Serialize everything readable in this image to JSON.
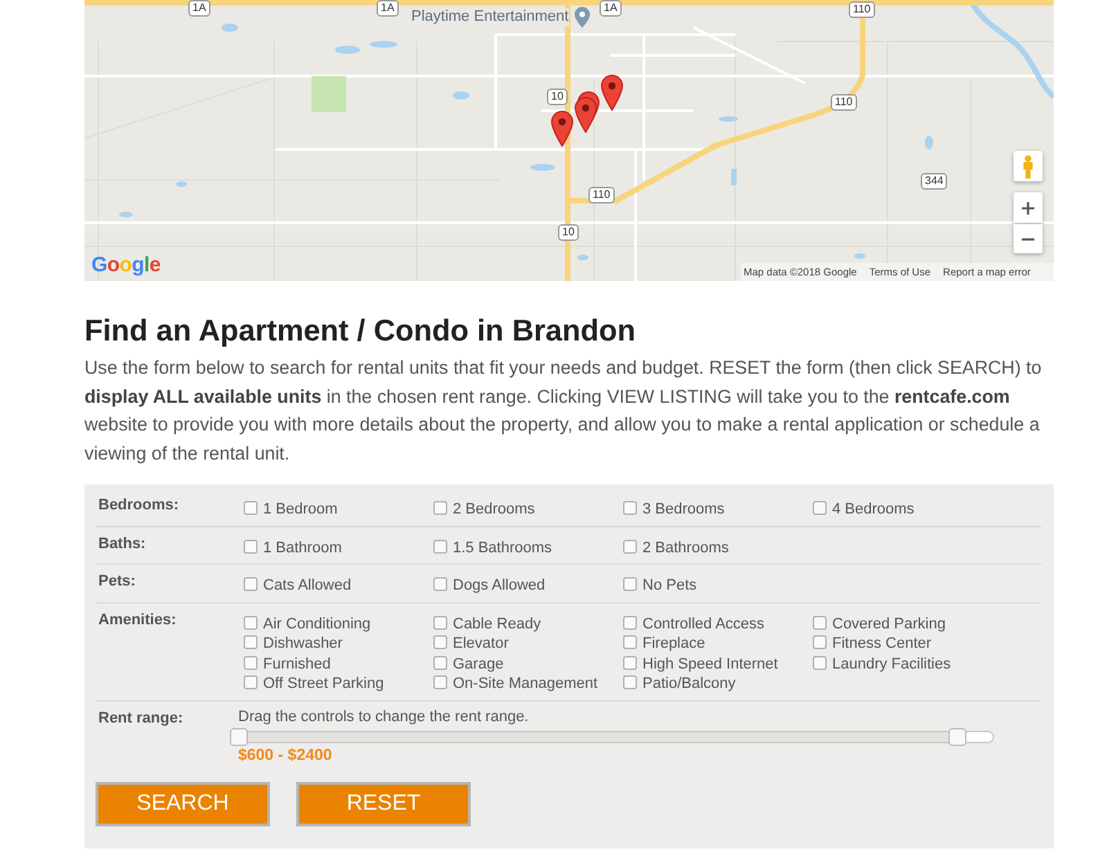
{
  "map": {
    "poi_label": "Playtime Entertainment",
    "road_shields": [
      "1A",
      "1A",
      "1A",
      "110",
      "110",
      "110",
      "10",
      "10",
      "344"
    ],
    "logo": "Google",
    "attribution": [
      "Map data ©2018 Google",
      "Terms of Use",
      "Report a map error"
    ]
  },
  "heading": "Find an Apartment / Condo in Brandon",
  "intro": "Use the form below to search for rental units that fit your needs and budget. RESET the form (then click SEARCH) to **display ALL available units** in the chosen rent range. Clicking VIEW LISTING will take you to the **rentcafe.com** website to provide you with more details about the property, and allow you to make a rental application or schedule a viewing of the rental unit.",
  "filters": [
    {
      "label": "Bedrooms:",
      "options": [
        {
          "label": "1 Bedroom",
          "checked": false
        },
        {
          "label": "2 Bedrooms",
          "checked": false
        },
        {
          "label": "3 Bedrooms",
          "checked": false
        },
        {
          "label": "4 Bedrooms",
          "checked": false
        }
      ]
    },
    {
      "label": "Baths:",
      "options": [
        {
          "label": "1 Bathroom",
          "checked": false
        },
        {
          "label": "1.5 Bathrooms",
          "checked": false
        },
        {
          "label": "2 Bathrooms",
          "checked": false
        }
      ]
    },
    {
      "label": "Pets:",
      "options": [
        {
          "label": "Cats Allowed",
          "checked": false
        },
        {
          "label": "Dogs Allowed",
          "checked": false
        },
        {
          "label": "No Pets",
          "checked": false
        }
      ]
    },
    {
      "label": "Amenities:",
      "options": [
        {
          "label": "Air Conditioning",
          "checked": false
        },
        {
          "label": "Cable Ready",
          "checked": false
        },
        {
          "label": "Controlled Access",
          "checked": false
        },
        {
          "label": "Covered Parking",
          "checked": false
        },
        {
          "label": "Dishwasher",
          "checked": false
        },
        {
          "label": "Elevator",
          "checked": false
        },
        {
          "label": "Fireplace",
          "checked": false
        },
        {
          "label": "Fitness Center",
          "checked": false
        },
        {
          "label": "Furnished",
          "checked": false
        },
        {
          "label": "Garage",
          "checked": false
        },
        {
          "label": "High Speed Internet",
          "checked": false
        },
        {
          "label": "Laundry Facilities",
          "checked": false
        },
        {
          "label": "Off Street Parking",
          "checked": false
        },
        {
          "label": "On-Site Management",
          "checked": false
        },
        {
          "label": "Patio/Balcony",
          "checked": false
        }
      ]
    }
  ],
  "rent_range": {
    "label": "Rent range:",
    "hint": "Drag the controls to change the rent range.",
    "handles": [
      {
        "level": 0
      },
      {
        "level": 0.95
      }
    ],
    "value": "$600 - $2400"
  },
  "buttons": [
    "SEARCH",
    "RESET"
  ]
}
